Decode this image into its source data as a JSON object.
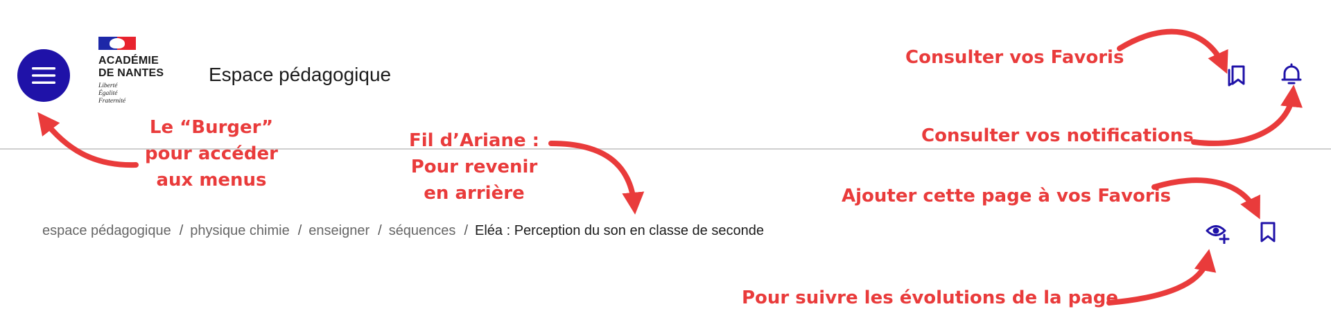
{
  "header": {
    "logo": {
      "line1": "ACADÉMIE",
      "line2": "DE NANTES",
      "motto": [
        "Liberté",
        "Égalité",
        "Fraternité"
      ]
    },
    "site_title": "Espace pédagogique",
    "menu_icon": "burger-menu-icon",
    "favorites_icon": "bookmarks-icon",
    "notifications_icon": "bell-icon"
  },
  "breadcrumb": {
    "items": [
      "espace pédagogique",
      "physique chimie",
      "enseigner",
      "séquences"
    ],
    "current": "Eléa : Perception du son en classe de seconde",
    "separator": "/"
  },
  "page_actions": {
    "follow_icon": "eye-plus-icon",
    "bookmark_icon": "bookmark-icon"
  },
  "annotations": {
    "favoris": "Consulter vos Favoris",
    "notifications": "Consulter vos notifications",
    "burger": [
      "Le “Burger”",
      "pour accéder",
      "aux menus"
    ],
    "ariane": [
      "Fil d’Ariane :",
      "Pour revenir",
      "en arrière"
    ],
    "add_favoris": "Ajouter cette page à vos Favoris",
    "suivre": "Pour suivre les évolutions de la page"
  },
  "colors": {
    "brand_blue": "#1f12a8",
    "annotation_red": "#e93b3b",
    "divider": "#cfcfcf"
  }
}
